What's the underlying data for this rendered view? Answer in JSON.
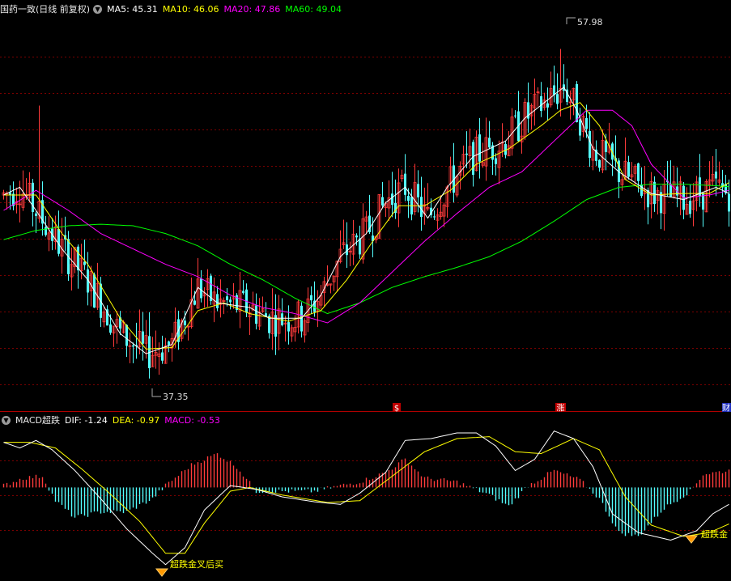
{
  "main_legend": {
    "stock_name": "国药一致(日线 前复权)",
    "ma5_label": "MA5: 45.31",
    "ma10_label": "MA10: 46.06",
    "ma20_label": "MA20: 47.86",
    "ma60_label": "MA60: 49.04",
    "colors": {
      "ma5": "#ffffff",
      "ma10": "#ffff00",
      "ma20": "#ff00ff",
      "ma60": "#00ff00"
    }
  },
  "sub_legend": {
    "indicator_name": "MACD超跌",
    "dif_label": "DIF: -1.24",
    "dea_label": "DEA: -0.97",
    "macd_label": "MACD: -0.53"
  },
  "markers": {
    "high_label": "57.98",
    "low_label": "37.35",
    "event_1": "$",
    "event_2": "涨",
    "event_3": "财",
    "signal_1": "超跌金叉后买",
    "signal_2": "超跌金"
  },
  "chart_data": [
    {
      "type": "candlestick",
      "title": "国药一致(日线 前复权)",
      "ylim": [
        35,
        60
      ],
      "annotations": {
        "high": 57.98,
        "low": 37.35
      },
      "last_values": {
        "MA5": 45.31,
        "MA10": 46.06,
        "MA20": 47.86,
        "MA60": 49.04
      },
      "ma5_anchor_points": [
        [
          0,
          48.5
        ],
        [
          5,
          49
        ],
        [
          10,
          47.5
        ],
        [
          18,
          45
        ],
        [
          26,
          43
        ],
        [
          36,
          39.5
        ],
        [
          44,
          38.2
        ],
        [
          52,
          38.8
        ],
        [
          60,
          42.5
        ],
        [
          66,
          41.5
        ],
        [
          76,
          41.2
        ],
        [
          82,
          40.5
        ],
        [
          92,
          40.5
        ],
        [
          98,
          42
        ],
        [
          104,
          44.5
        ],
        [
          112,
          46
        ],
        [
          118,
          48
        ],
        [
          124,
          49
        ],
        [
          131,
          47
        ],
        [
          137,
          49
        ],
        [
          145,
          51
        ],
        [
          155,
          52
        ],
        [
          161,
          53.5
        ],
        [
          167,
          54.5
        ],
        [
          173,
          55.5
        ],
        [
          177,
          54
        ],
        [
          182,
          51.5
        ],
        [
          190,
          50
        ],
        [
          200,
          48.6
        ],
        [
          210,
          48.2
        ],
        [
          220,
          49
        ],
        [
          224,
          48.6
        ]
      ],
      "ma10_anchor_points": [
        [
          0,
          48.5
        ],
        [
          10,
          48.5
        ],
        [
          18,
          46
        ],
        [
          26,
          44
        ],
        [
          36,
          40.5
        ],
        [
          44,
          38.5
        ],
        [
          52,
          38.6
        ],
        [
          60,
          41
        ],
        [
          68,
          41.5
        ],
        [
          76,
          40.8
        ],
        [
          88,
          40.3
        ],
        [
          98,
          41
        ],
        [
          106,
          43
        ],
        [
          114,
          45.5
        ],
        [
          122,
          47.8
        ],
        [
          130,
          47.8
        ],
        [
          138,
          48.8
        ],
        [
          146,
          50.5
        ],
        [
          156,
          51.5
        ],
        [
          166,
          53
        ],
        [
          172,
          54
        ],
        [
          178,
          54.5
        ],
        [
          184,
          53
        ],
        [
          192,
          49.5
        ],
        [
          200,
          48.5
        ],
        [
          210,
          48.6
        ],
        [
          218,
          48.6
        ],
        [
          224,
          49.3
        ]
      ],
      "ma20_anchor_points": [
        [
          0,
          47.5
        ],
        [
          10,
          48.8
        ],
        [
          20,
          47.5
        ],
        [
          30,
          46
        ],
        [
          40,
          45
        ],
        [
          50,
          44
        ],
        [
          60,
          43.2
        ],
        [
          70,
          42
        ],
        [
          80,
          41.2
        ],
        [
          90,
          40.8
        ],
        [
          100,
          40.2
        ],
        [
          110,
          41.5
        ],
        [
          120,
          43.5
        ],
        [
          130,
          45.5
        ],
        [
          140,
          47.3
        ],
        [
          150,
          49
        ],
        [
          160,
          50
        ],
        [
          170,
          52
        ],
        [
          180,
          54
        ],
        [
          188,
          54
        ],
        [
          194,
          53
        ],
        [
          200,
          50.5
        ],
        [
          210,
          48.3
        ],
        [
          218,
          48.5
        ],
        [
          224,
          48.8
        ]
      ],
      "ma60_anchor_points": [
        [
          0,
          45.6
        ],
        [
          10,
          46.2
        ],
        [
          20,
          46.5
        ],
        [
          30,
          46.6
        ],
        [
          40,
          46.5
        ],
        [
          50,
          46
        ],
        [
          60,
          45.2
        ],
        [
          70,
          44
        ],
        [
          80,
          43
        ],
        [
          90,
          41.8
        ],
        [
          100,
          40.8
        ],
        [
          110,
          41.5
        ],
        [
          120,
          42.5
        ],
        [
          130,
          43.2
        ],
        [
          140,
          43.8
        ],
        [
          150,
          44.5
        ],
        [
          160,
          45.5
        ],
        [
          170,
          46.8
        ],
        [
          180,
          48.2
        ],
        [
          190,
          49
        ],
        [
          200,
          49.2
        ],
        [
          210,
          49.2
        ],
        [
          220,
          49.1
        ],
        [
          224,
          49.04
        ]
      ]
    },
    {
      "type": "macd",
      "title": "MACD超跌",
      "ylim": [
        -2.4,
        1.6
      ],
      "last_values": {
        "DIF": -1.24,
        "DEA": -0.97,
        "MACD": -0.53
      },
      "dif_anchor_points": [
        [
          0,
          1.2
        ],
        [
          5,
          1.05
        ],
        [
          10,
          1.25
        ],
        [
          15,
          1
        ],
        [
          22,
          0.45
        ],
        [
          30,
          -0.3
        ],
        [
          38,
          -1.1
        ],
        [
          46,
          -1.75
        ],
        [
          50,
          -2.05
        ],
        [
          56,
          -1.6
        ],
        [
          62,
          -0.6
        ],
        [
          70,
          0.05
        ],
        [
          78,
          -0.05
        ],
        [
          86,
          -0.25
        ],
        [
          96,
          -0.38
        ],
        [
          104,
          -0.45
        ],
        [
          110,
          -0.15
        ],
        [
          118,
          0.4
        ],
        [
          124,
          1.25
        ],
        [
          132,
          1.3
        ],
        [
          140,
          1.45
        ],
        [
          146,
          1.45
        ],
        [
          152,
          1.1
        ],
        [
          158,
          0.45
        ],
        [
          164,
          0.75
        ],
        [
          170,
          1.5
        ],
        [
          176,
          1.3
        ],
        [
          182,
          0.55
        ],
        [
          188,
          -0.7
        ],
        [
          196,
          -1.2
        ],
        [
          206,
          -1.4
        ],
        [
          214,
          -1.15
        ],
        [
          219,
          -0.7
        ],
        [
          224,
          -0.45
        ]
      ],
      "dea_anchor_points": [
        [
          0,
          1.2
        ],
        [
          8,
          1.2
        ],
        [
          16,
          1.05
        ],
        [
          24,
          0.5
        ],
        [
          32,
          -0.1
        ],
        [
          42,
          -0.9
        ],
        [
          50,
          -1.75
        ],
        [
          56,
          -1.75
        ],
        [
          62,
          -0.95
        ],
        [
          70,
          -0.1
        ],
        [
          76,
          0
        ],
        [
          86,
          -0.2
        ],
        [
          100,
          -0.4
        ],
        [
          110,
          -0.35
        ],
        [
          120,
          0.3
        ],
        [
          130,
          0.95
        ],
        [
          140,
          1.3
        ],
        [
          150,
          1.35
        ],
        [
          158,
          0.95
        ],
        [
          166,
          0.9
        ],
        [
          176,
          1.3
        ],
        [
          184,
          1
        ],
        [
          192,
          -0.25
        ],
        [
          200,
          -1
        ],
        [
          210,
          -1.3
        ],
        [
          218,
          -1.2
        ],
        [
          224,
          -0.97
        ]
      ],
      "histogram_anchor_points": [
        [
          0,
          0.05
        ],
        [
          6,
          0.25
        ],
        [
          12,
          0.3
        ],
        [
          16,
          -0.35
        ],
        [
          22,
          -0.8
        ],
        [
          30,
          -0.65
        ],
        [
          38,
          -0.65
        ],
        [
          46,
          -0.3
        ],
        [
          50,
          0.05
        ],
        [
          58,
          0.6
        ],
        [
          66,
          0.9
        ],
        [
          72,
          0.55
        ],
        [
          78,
          -0.1
        ],
        [
          86,
          -0.1
        ],
        [
          96,
          -0.1
        ],
        [
          104,
          0.05
        ],
        [
          110,
          0.15
        ],
        [
          118,
          0.4
        ],
        [
          124,
          0.75
        ],
        [
          130,
          0.25
        ],
        [
          140,
          0.15
        ],
        [
          150,
          -0.2
        ],
        [
          156,
          -0.5
        ],
        [
          162,
          0.05
        ],
        [
          170,
          0.45
        ],
        [
          178,
          0.2
        ],
        [
          184,
          -0.3
        ],
        [
          190,
          -1.2
        ],
        [
          196,
          -1.3
        ],
        [
          204,
          -0.55
        ],
        [
          212,
          -0.1
        ],
        [
          216,
          0.35
        ],
        [
          224,
          0.45
        ]
      ]
    }
  ]
}
